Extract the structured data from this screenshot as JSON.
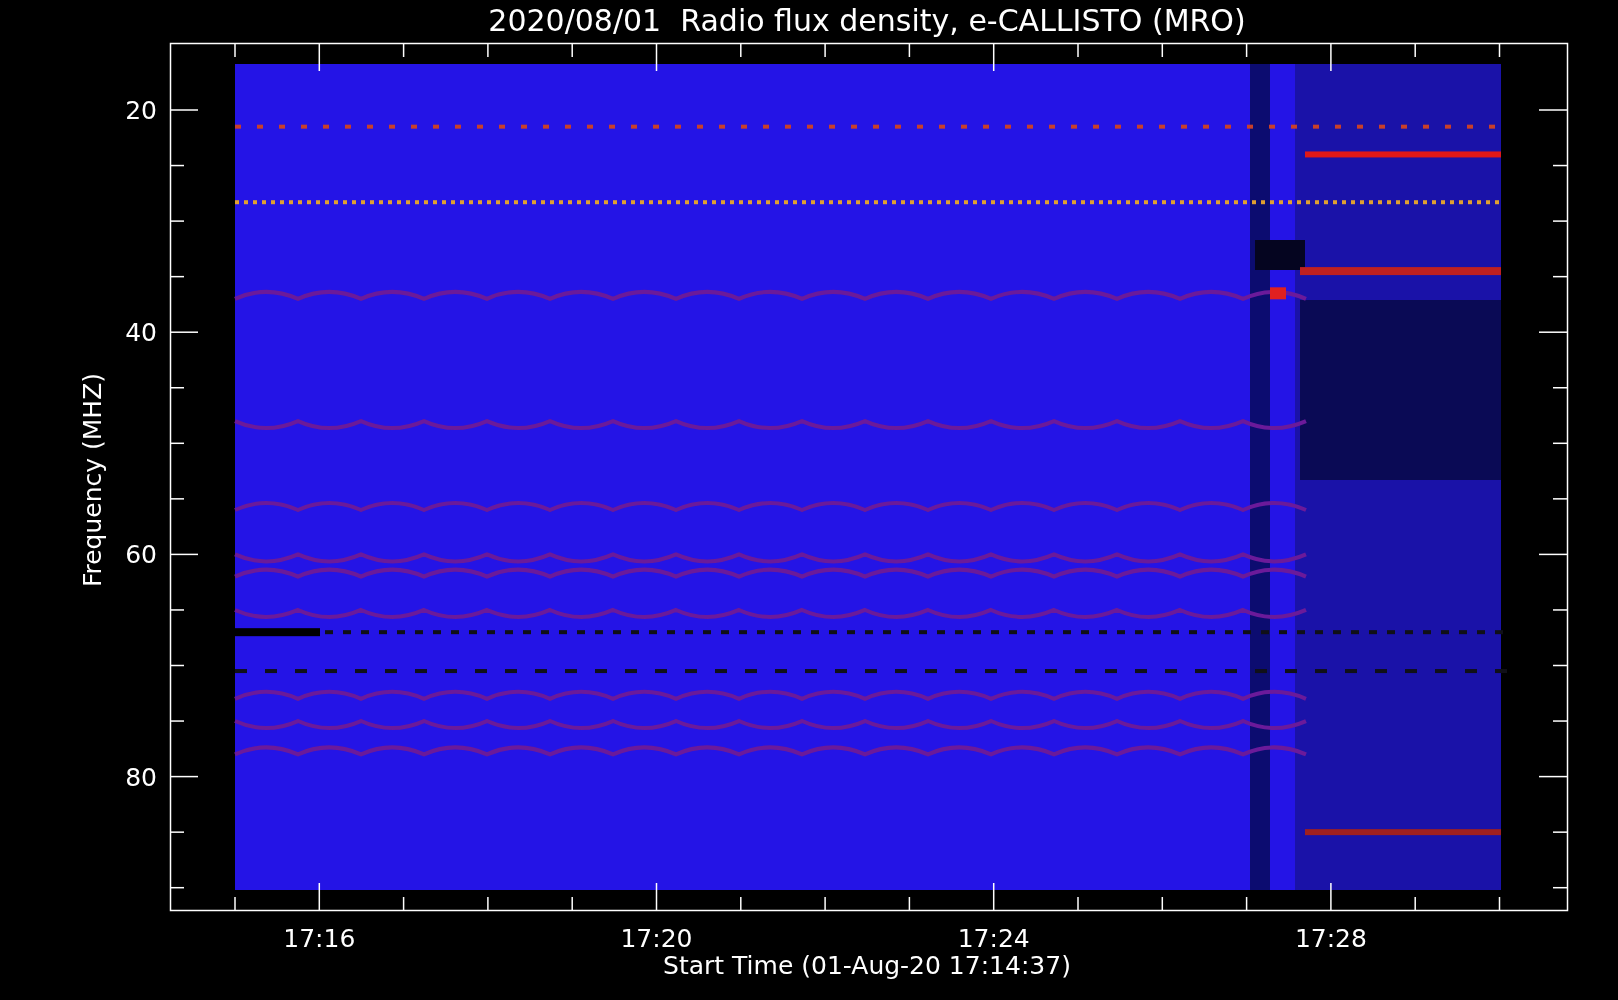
{
  "title": "2020/08/01  Radio flux density, e-CALLISTO (MRO)",
  "y_axis": {
    "label": "Frequency (MHZ)",
    "ticks": [
      "20",
      "40",
      "60",
      "80"
    ]
  },
  "x_axis": {
    "label": "Start Time (01-Aug-20 17:14:37)",
    "ticks": [
      "17:16",
      "17:20",
      "17:24",
      "17:28"
    ]
  }
}
